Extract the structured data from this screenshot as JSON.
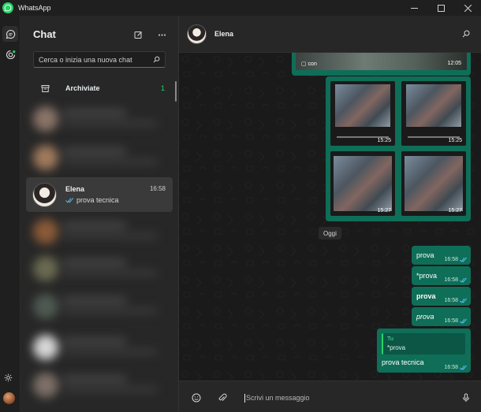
{
  "window": {
    "title": "WhatsApp",
    "minimize_icon": "minimize-icon",
    "maximize_icon": "maximize-icon",
    "close_icon": "close-icon"
  },
  "rail": {
    "items": [
      {
        "icon": "chats-icon",
        "active": true
      },
      {
        "icon": "status-icon",
        "active": false
      }
    ],
    "bottom": [
      "settings-icon",
      "profile-avatar"
    ]
  },
  "chatlist": {
    "title": "Chat",
    "new_chat_icon": "new-chat-icon",
    "menu_icon": "more-options-icon",
    "search": {
      "placeholder": "Cerca o inizia una nuova chat"
    },
    "archived": {
      "label": "Archiviate",
      "count": "1"
    },
    "active_chat": {
      "name": "Elena",
      "time": "16:58",
      "preview": "prova tecnica",
      "status": "read"
    }
  },
  "conversation": {
    "contact_name": "Elena",
    "search_icon": "search-icon",
    "top_media": {
      "label": "▢ con",
      "time": "12:05"
    },
    "media_times": [
      "15:25",
      "15:25",
      "15:27",
      "15:27"
    ],
    "day_separator": "Oggi",
    "messages": [
      {
        "text": "prova",
        "time": "16:58",
        "style": "normal"
      },
      {
        "text": "*prova",
        "time": "16:58",
        "style": "normal"
      },
      {
        "text": "prova",
        "time": "16:58",
        "style": "bold"
      },
      {
        "text": "prova",
        "time": "16:58",
        "style": "italic"
      }
    ],
    "reply_message": {
      "quoted_author": "Tu",
      "quoted_text": "*prova",
      "text": "prova tecnica",
      "time": "16:58"
    },
    "composer": {
      "placeholder": "Scrivi un messaggio"
    }
  },
  "colors": {
    "accent": "#25d366",
    "bubble_out": "#0f6e57",
    "read_ticks": "#53bdeb"
  }
}
